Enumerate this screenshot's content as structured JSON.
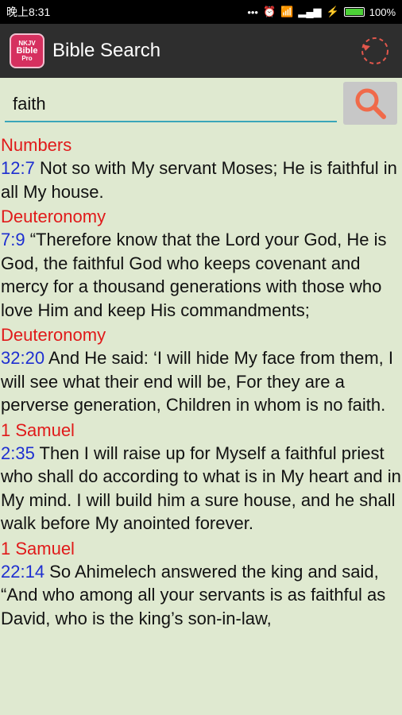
{
  "status": {
    "time": "晚上8:31",
    "battery": "100%"
  },
  "app_bar": {
    "title": "Bible Search",
    "icon_top": "NKJV",
    "icon_mid": "Bible",
    "icon_bot": "Pro"
  },
  "search": {
    "value": "faith"
  },
  "results": [
    {
      "book": "Numbers",
      "ref": "12:7",
      "text": " Not so with My servant Moses; He is faithful in all My house."
    },
    {
      "book": "Deuteronomy",
      "ref": "7:9",
      "text": " “Therefore know that the Lord your God, He is God, the faithful God who keeps covenant and mercy for a thousand generations with those who love Him and keep His commandments;"
    },
    {
      "book": "Deuteronomy",
      "ref": "32:20",
      "text": " And He said: ‘I will hide My face from them, I will see what their end will be, For they are a perverse generation, Children in whom is no faith."
    },
    {
      "book": "1 Samuel",
      "ref": "2:35",
      "text": " Then I will raise up for Myself a faithful priest who shall do according to what is in My heart and in My mind. I will build him a sure house, and he shall walk before My anointed forever."
    },
    {
      "book": "1 Samuel",
      "ref": "22:14",
      "text": " So Ahimelech answered the king and said, “And who among all your servants is as faithful as David, who is the king’s son-in-law,"
    }
  ],
  "colors": {
    "background": "#dfe9d0",
    "book": "#e01a1a",
    "reference": "#1e2fd1",
    "underline": "#3aa6b9",
    "search_icon": "#f06a4a"
  }
}
